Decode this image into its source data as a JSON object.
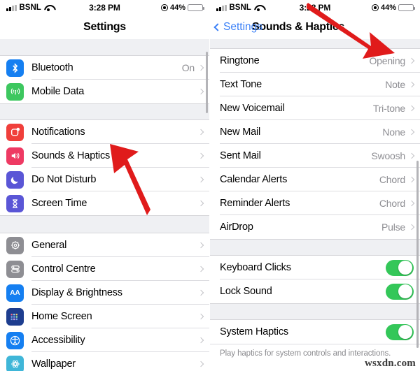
{
  "status_bar": {
    "carrier": "BSNL",
    "time": "3:28 PM",
    "battery_percent": "44%",
    "signal_icon": "signal-bars-icon",
    "wifi_icon": "wifi-icon",
    "location_icon": "location-services-icon",
    "battery_icon": "battery-icon"
  },
  "colors": {
    "accent_blue": "#3b80f7",
    "toggle_green": "#34c759",
    "arrow_red": "#e01b1b",
    "value_gray": "#8e8e93",
    "group_bg": "#eff0f3"
  },
  "left_panel": {
    "title": "Settings",
    "groups": [
      {
        "rows": [
          {
            "label": "Bluetooth",
            "value": "On",
            "icon": "bluetooth-icon",
            "icon_color": "#157ff1"
          },
          {
            "label": "Mobile Data",
            "value": "",
            "icon": "mobile-data-icon",
            "icon_color": "#3dc75f"
          }
        ]
      },
      {
        "rows": [
          {
            "label": "Notifications",
            "value": "",
            "icon": "notifications-icon",
            "icon_color": "#f03f3b"
          },
          {
            "label": "Sounds & Haptics",
            "value": "",
            "icon": "sounds-haptics-icon",
            "icon_color": "#ee3a63"
          },
          {
            "label": "Do Not Disturb",
            "value": "",
            "icon": "do-not-disturb-icon",
            "icon_color": "#5a56d6"
          },
          {
            "label": "Screen Time",
            "value": "",
            "icon": "screen-time-icon",
            "icon_color": "#5a56d6"
          }
        ]
      },
      {
        "rows": [
          {
            "label": "General",
            "value": "",
            "icon": "general-gear-icon",
            "icon_color": "#8e8e93"
          },
          {
            "label": "Control Centre",
            "value": "",
            "icon": "control-centre-icon",
            "icon_color": "#8e8e93"
          },
          {
            "label": "Display & Brightness",
            "value": "",
            "icon": "display-brightness-icon",
            "icon_color": "#157ff1"
          },
          {
            "label": "Home Screen",
            "value": "",
            "icon": "home-screen-icon",
            "icon_color": "#1d3d8f"
          },
          {
            "label": "Accessibility",
            "value": "",
            "icon": "accessibility-icon",
            "icon_color": "#157ff1"
          },
          {
            "label": "Wallpaper",
            "value": "",
            "icon": "wallpaper-icon",
            "icon_color": "#3fb6d8"
          }
        ]
      }
    ]
  },
  "right_panel": {
    "back_label": "Settings",
    "title": "Sounds & Haptics",
    "sound_rows": [
      {
        "label": "Ringtone",
        "value": "Opening"
      },
      {
        "label": "Text Tone",
        "value": "Note"
      },
      {
        "label": "New Voicemail",
        "value": "Tri-tone"
      },
      {
        "label": "New Mail",
        "value": "None"
      },
      {
        "label": "Sent Mail",
        "value": "Swoosh"
      },
      {
        "label": "Calendar Alerts",
        "value": "Chord"
      },
      {
        "label": "Reminder Alerts",
        "value": "Chord"
      },
      {
        "label": "AirDrop",
        "value": "Pulse"
      }
    ],
    "toggle_rows": [
      {
        "label": "Keyboard Clicks",
        "state": "on"
      },
      {
        "label": "Lock Sound",
        "state": "on"
      }
    ],
    "haptics_row": {
      "label": "System Haptics",
      "state": "on"
    },
    "footnote": "Play haptics for system controls and interactions."
  },
  "annotations": {
    "left_arrow": "arrow-pointing-to-sounds-haptics",
    "right_arrow": "arrow-pointing-to-keyboard-clicks-toggle"
  },
  "watermark": "wsxdn.com"
}
